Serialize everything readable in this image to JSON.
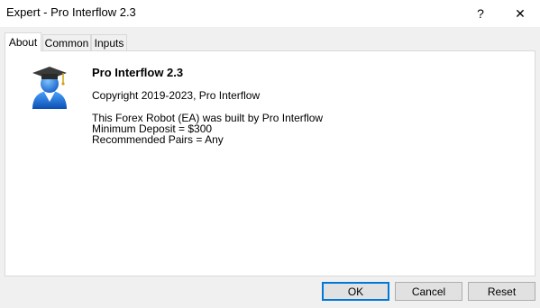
{
  "window": {
    "title": "Expert - Pro Interflow 2.3",
    "help_glyph": "?",
    "close_glyph": "✕"
  },
  "tabs": [
    {
      "label": "About",
      "active": true
    },
    {
      "label": "Common",
      "active": false
    },
    {
      "label": "Inputs",
      "active": false
    }
  ],
  "about": {
    "icon": "graduate-user-icon",
    "name": "Pro Interflow 2.3",
    "copyright": "Copyright 2019-2023, Pro Interflow",
    "description": [
      "This Forex Robot (EA) was built by Pro Interflow",
      "Minimum Deposit = $300",
      "Recommended Pairs = Any"
    ]
  },
  "buttons": {
    "ok": "OK",
    "cancel": "Cancel",
    "reset": "Reset"
  },
  "colors": {
    "accent": "#0078d7",
    "icon_blue": "#1f7be0"
  }
}
